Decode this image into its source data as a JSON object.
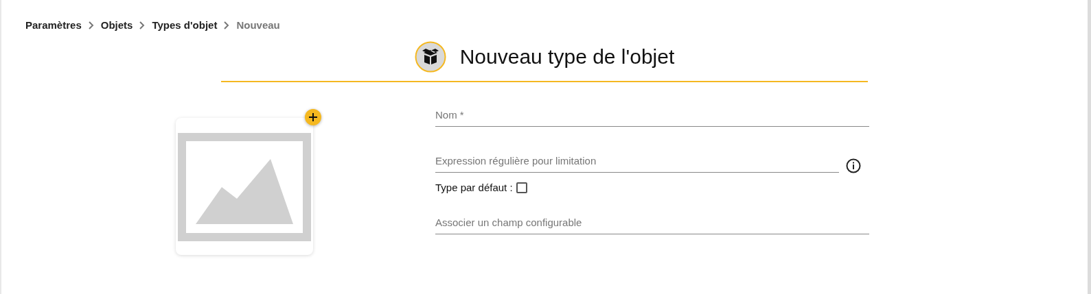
{
  "breadcrumb": [
    {
      "label": "Paramètres",
      "current": false
    },
    {
      "label": "Objets",
      "current": false
    },
    {
      "label": "Types d'objet",
      "current": false
    },
    {
      "label": "Nouveau",
      "current": true
    }
  ],
  "title": "Nouveau type de l'objet",
  "fields": [
    {
      "kind": "text",
      "placeholder": "Nom *"
    },
    {
      "kind": "text_info",
      "placeholder": "Expression régulière pour limitation"
    },
    {
      "kind": "checkbox",
      "label": "Type par défaut :",
      "checked": false
    },
    {
      "kind": "text",
      "placeholder": "Associer un champ configurable"
    }
  ]
}
